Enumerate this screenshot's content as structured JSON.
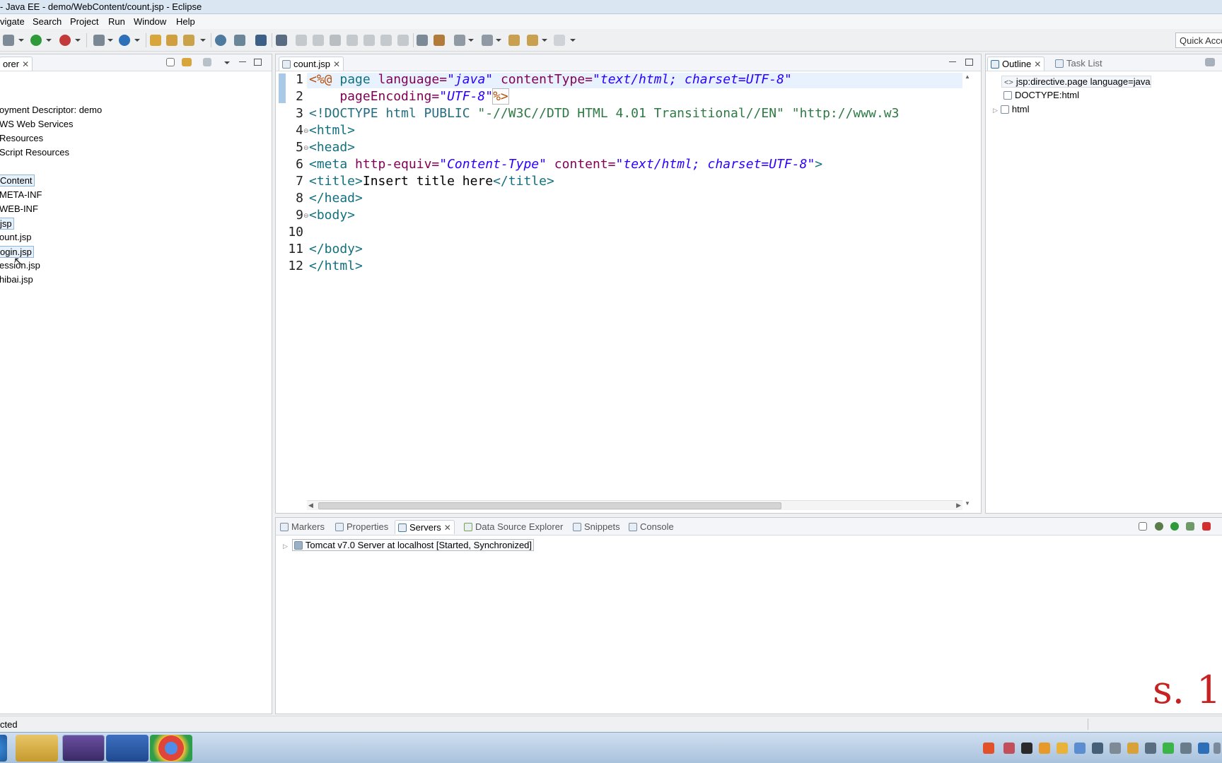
{
  "window": {
    "title": "- Java EE - demo/WebContent/count.jsp - Eclipse"
  },
  "menu": {
    "items": [
      "vigate",
      "Search",
      "Project",
      "Run",
      "Window",
      "Help"
    ]
  },
  "toolbar": {
    "quick_access": "Quick Access"
  },
  "explorer": {
    "tab_label": "orer",
    "items": [
      "oyment Descriptor: demo",
      "WS Web Services",
      "Resources",
      "Script Resources",
      "Content",
      "META-INF",
      "WEB-INF",
      "jsp",
      "ount.jsp",
      "ogin.jsp",
      "ession.jsp",
      "hibai.jsp"
    ]
  },
  "editor": {
    "tab_label": "count.jsp",
    "line_numbers": [
      "1",
      "2",
      "3",
      "4",
      "5",
      "6",
      "7",
      "8",
      "9",
      "10",
      "11",
      "12"
    ],
    "lines": {
      "l1": {
        "a": "<%@",
        "b": " page ",
        "c": "language=",
        "d": "\"java\"",
        "e": " contentType=",
        "f": "\"text/html; charset=UTF-8\""
      },
      "l2": {
        "a": "    pageEncoding=",
        "b": "\"UTF-8\"",
        "c": "%>"
      },
      "l3": {
        "a": "<!DOCTYPE html PUBLIC ",
        "b": "\"-//W3C//DTD HTML 4.01 Transitional//EN\" \"http://www.w3"
      },
      "l4": "<html>",
      "l5": "<head>",
      "l6": {
        "a": "<meta ",
        "b": "http-equiv=",
        "c": "\"Content-Type\"",
        "d": " content=",
        "e": "\"text/html; charset=UTF-8\"",
        "f": ">"
      },
      "l7": {
        "a": "<title>",
        "b": "Insert title here",
        "c": "</title>"
      },
      "l8": "</head>",
      "l9": "<body>",
      "l11": "</body>",
      "l12": "</html>"
    }
  },
  "outline": {
    "tab_outline": "Outline",
    "tab_tasklist": "Task List",
    "items": [
      "jsp:directive.page language=java",
      "DOCTYPE:html",
      "html"
    ]
  },
  "bottom": {
    "tabs": [
      "Markers",
      "Properties",
      "Servers",
      "Data Source Explorer",
      "Snippets",
      "Console"
    ],
    "server_entry": "Tomcat v7.0 Server at localhost  [Started, Synchronized]"
  },
  "status": {
    "text": "cted"
  },
  "watermark": "s. 1",
  "colors": {
    "accent": "#2f7fd0",
    "error": "#d32f2f",
    "run": "#2e9a3a"
  }
}
